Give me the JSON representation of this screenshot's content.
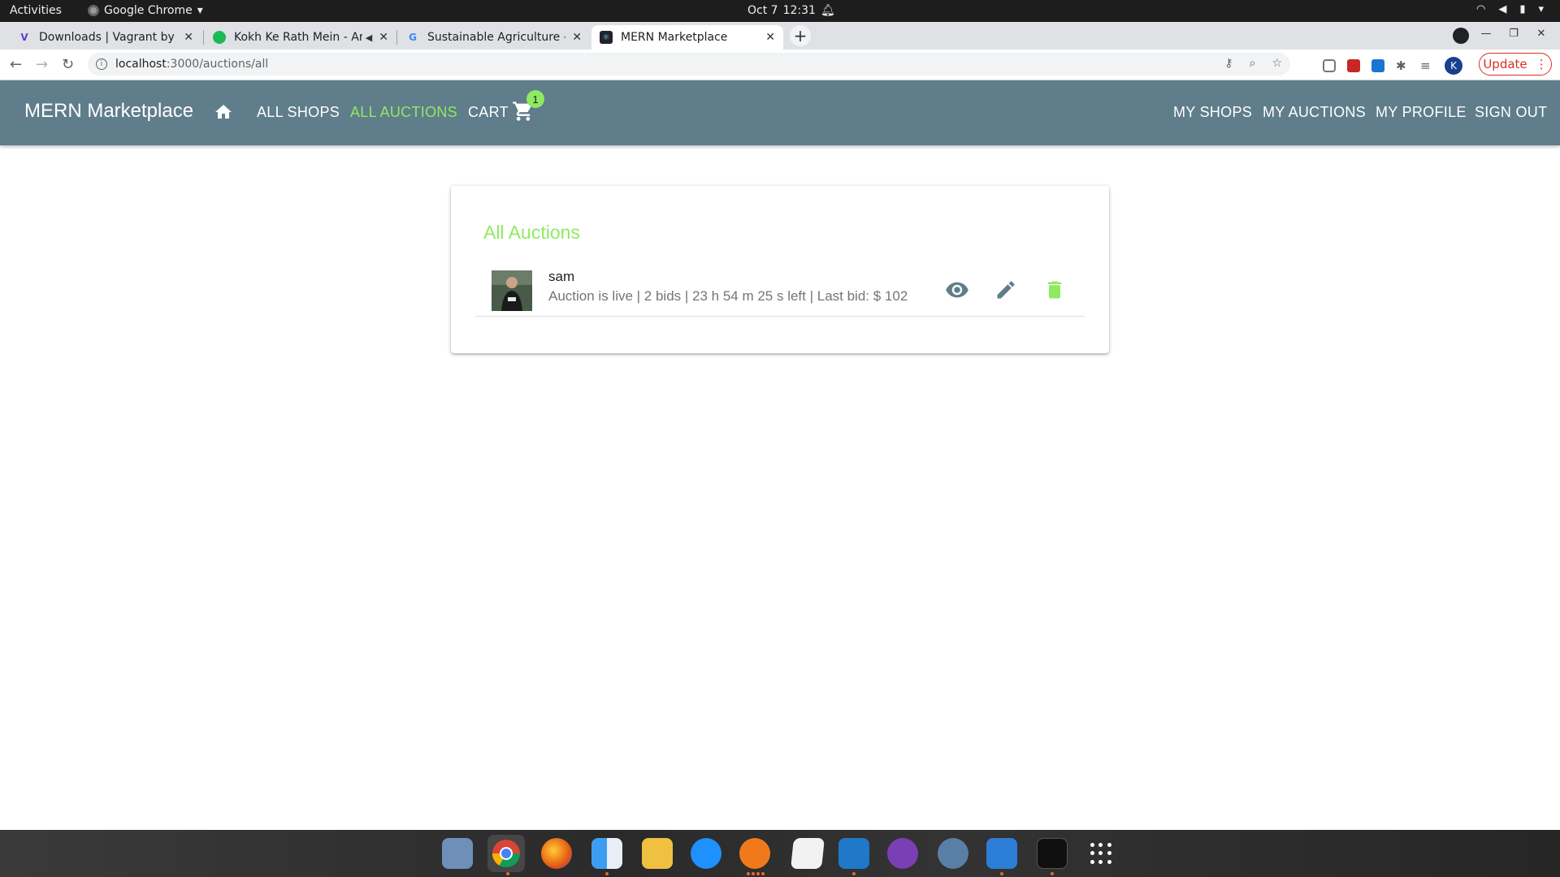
{
  "system": {
    "activities": "Activities",
    "app_name": "Google Chrome",
    "date": "Oct 7",
    "time": "12:31"
  },
  "browser": {
    "tabs": [
      {
        "title": "Downloads | Vagrant by H",
        "favicon": "vagrant-icon",
        "color": "#5d3fd3"
      },
      {
        "title": "Kokh Ke Rath Mein - Ar",
        "favicon": "spotify-icon",
        "color": "#1db954"
      },
      {
        "title": "Sustainable Agriculture - (",
        "favicon": "google-icon",
        "color": "#4285f4"
      },
      {
        "title": "MERN Marketplace",
        "favicon": "react-icon",
        "color": "#20232a"
      }
    ],
    "url_host": "localhost",
    "url_path": ":3000/auctions/all",
    "profile_initial": "K",
    "update_label": "Update"
  },
  "appbar": {
    "brand": "MERN Marketplace",
    "nav_left": [
      "ALL SHOPS",
      "ALL AUCTIONS",
      "CART"
    ],
    "nav_right": [
      "MY SHOPS",
      "MY AUCTIONS",
      "MY PROFILE",
      "SIGN OUT"
    ],
    "cart_count": "1",
    "accent_color": "#8eea62",
    "bar_color": "#607d8b"
  },
  "main": {
    "title": "All Auctions",
    "auctions": [
      {
        "name": "sam",
        "status": "Auction is live | 2 bids | 23 h 54 m 25 s left | Last bid: $ 102"
      }
    ]
  }
}
